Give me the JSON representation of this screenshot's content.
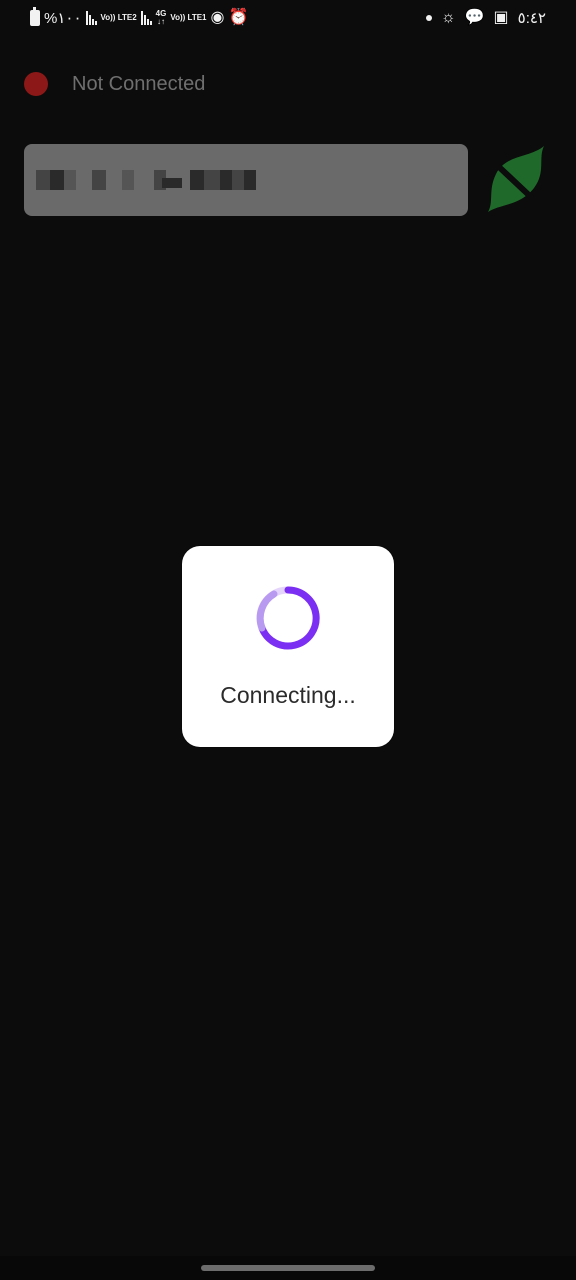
{
  "status_bar": {
    "battery_text": "%١٠٠",
    "network_left": "Vo)) LTE2",
    "network_right_top": "4G",
    "network_right_volte": "Vo)) LTE1",
    "time": "٥:٤٢",
    "icons": [
      "battery-icon",
      "signal-icon",
      "volte-icon",
      "4g-icon",
      "hotspot-icon",
      "alarm-icon",
      "dot-icon",
      "brightness-icon",
      "chat-bubble-icon",
      "gallery-icon"
    ]
  },
  "connection": {
    "status": "Not Connected",
    "status_color": "#8d1818",
    "connect_icon": "shield-disconnected-icon",
    "connect_icon_color": "#1f6a2a"
  },
  "server_field": {
    "value": "",
    "note": "pixelated/redacted server address"
  },
  "dialog": {
    "label": "Connecting...",
    "spinner_color": "#7b2ff2"
  }
}
